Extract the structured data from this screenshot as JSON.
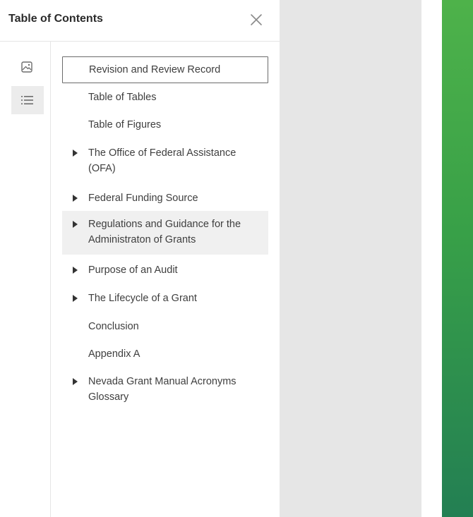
{
  "panel": {
    "title": "Table of Contents",
    "close_icon": "close-icon"
  },
  "rail": {
    "thumbnails_icon": "image-thumbnails-icon",
    "outline_icon": "list-outline-icon",
    "active": "outline"
  },
  "toc": {
    "items": [
      {
        "label": "Revision and Review Record",
        "expandable": false,
        "state": "selected"
      },
      {
        "label": "Table of Tables",
        "expandable": false,
        "state": ""
      },
      {
        "label": "Table of Figures",
        "expandable": false,
        "state": ""
      },
      {
        "label": "The Office of Federal Assistance (OFA)",
        "expandable": true,
        "state": ""
      },
      {
        "label": "Federal Funding Source",
        "expandable": true,
        "state": ""
      },
      {
        "label": "Regulations and Guidance for the Administraton of Grants",
        "expandable": true,
        "state": "hover"
      },
      {
        "label": "Purpose of an Audit",
        "expandable": true,
        "state": ""
      },
      {
        "label": "The Lifecycle of a Grant",
        "expandable": true,
        "state": ""
      },
      {
        "label": "Conclusion",
        "expandable": false,
        "state": ""
      },
      {
        "label": "Appendix A",
        "expandable": false,
        "state": ""
      },
      {
        "label": "Nevada Grant Manual Acronyms Glossary",
        "expandable": true,
        "state": ""
      }
    ]
  },
  "colors": {
    "page_accent": "#3aa047",
    "background_gray": "#e6e6e6"
  }
}
